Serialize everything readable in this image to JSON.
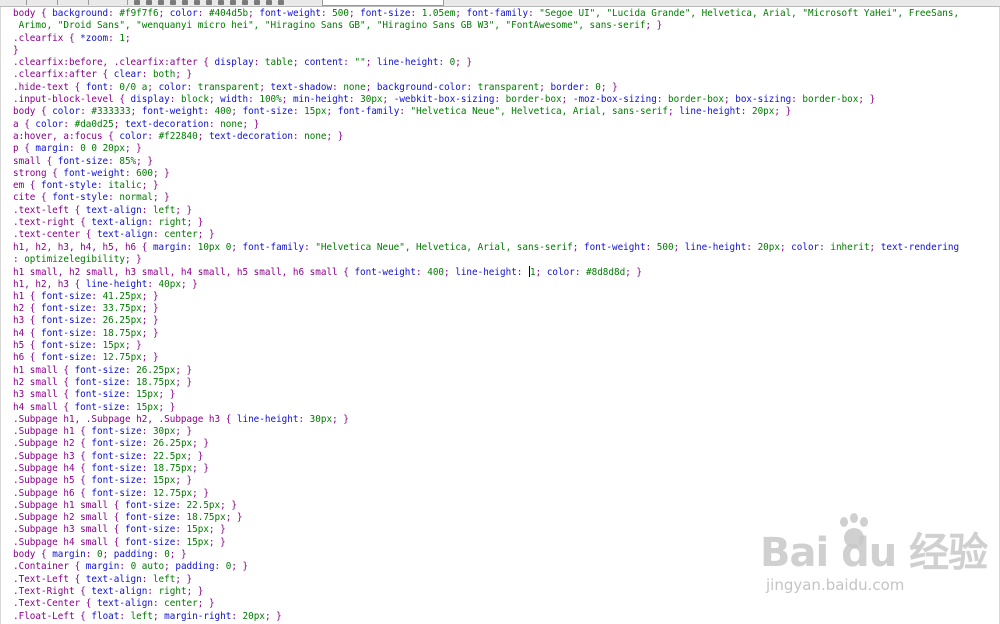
{
  "colors": {
    "selector": "#8a008a",
    "property": "#1010d0",
    "value": "#007a00",
    "background": "#ffffff"
  },
  "icons": [
    "toolbar-icon",
    "paw-icon"
  ],
  "watermark": {
    "logo": "Bai du 经验",
    "url": "jingyan.baidu.com"
  },
  "lines": [
    [
      [
        "s",
        "body { "
      ],
      [
        "p",
        "background"
      ],
      [
        "s",
        ": "
      ],
      [
        "v",
        "#f9f7f6"
      ],
      [
        "s",
        "; "
      ],
      [
        "p",
        "color"
      ],
      [
        "s",
        ": "
      ],
      [
        "v",
        "#404d5b"
      ],
      [
        "s",
        "; "
      ],
      [
        "p",
        "font-weight"
      ],
      [
        "s",
        ": "
      ],
      [
        "v",
        "500"
      ],
      [
        "s",
        "; "
      ],
      [
        "p",
        "font-size"
      ],
      [
        "s",
        ": "
      ],
      [
        "v",
        "1.05em"
      ],
      [
        "s",
        "; "
      ],
      [
        "p",
        "font-family"
      ],
      [
        "s",
        ": "
      ],
      [
        "v",
        "\"Segoe UI\", \"Lucida Grande\", Helvetica, Arial, \"Microsoft YaHei\", FreeSans,"
      ]
    ],
    [
      [
        "v",
        " Arimo, \"Droid Sans\", \"wenquanyi micro hei\", \"Hiragino Sans GB\", \"Hiragino Sans GB W3\", \"FontAwesome\", sans-serif"
      ],
      [
        "s",
        "; }"
      ]
    ],
    [
      [
        "s",
        ".clearfix { "
      ],
      [
        "p",
        "*zoom"
      ],
      [
        "s",
        ": "
      ],
      [
        "v",
        "1"
      ],
      [
        "s",
        ";"
      ]
    ],
    [
      [
        "s",
        "}"
      ]
    ],
    [
      [
        "s",
        ".clearfix:before, .clearfix:after { "
      ],
      [
        "p",
        "display"
      ],
      [
        "s",
        ": "
      ],
      [
        "v",
        "table"
      ],
      [
        "s",
        "; "
      ],
      [
        "p",
        "content"
      ],
      [
        "s",
        ": "
      ],
      [
        "v",
        "\"\""
      ],
      [
        "s",
        "; "
      ],
      [
        "p",
        "line-height"
      ],
      [
        "s",
        ": "
      ],
      [
        "v",
        "0"
      ],
      [
        "s",
        "; }"
      ]
    ],
    [
      [
        "s",
        ".clearfix:after { "
      ],
      [
        "p",
        "clear"
      ],
      [
        "s",
        ": "
      ],
      [
        "v",
        "both"
      ],
      [
        "s",
        "; }"
      ]
    ],
    [
      [
        "s",
        ".hide-text { "
      ],
      [
        "p",
        "font"
      ],
      [
        "s",
        ": "
      ],
      [
        "v",
        "0/0 a"
      ],
      [
        "s",
        "; "
      ],
      [
        "p",
        "color"
      ],
      [
        "s",
        ": "
      ],
      [
        "v",
        "transparent"
      ],
      [
        "s",
        "; "
      ],
      [
        "p",
        "text-shadow"
      ],
      [
        "s",
        ": "
      ],
      [
        "v",
        "none"
      ],
      [
        "s",
        "; "
      ],
      [
        "p",
        "background-color"
      ],
      [
        "s",
        ": "
      ],
      [
        "v",
        "transparent"
      ],
      [
        "s",
        "; "
      ],
      [
        "p",
        "border"
      ],
      [
        "s",
        ": "
      ],
      [
        "v",
        "0"
      ],
      [
        "s",
        "; }"
      ]
    ],
    [
      [
        "s",
        ".input-block-level { "
      ],
      [
        "p",
        "display"
      ],
      [
        "s",
        ": "
      ],
      [
        "v",
        "block"
      ],
      [
        "s",
        "; "
      ],
      [
        "p",
        "width"
      ],
      [
        "s",
        ": "
      ],
      [
        "v",
        "100%"
      ],
      [
        "s",
        "; "
      ],
      [
        "p",
        "min-height"
      ],
      [
        "s",
        ": "
      ],
      [
        "v",
        "30px"
      ],
      [
        "s",
        "; "
      ],
      [
        "p",
        "-webkit-box-sizing"
      ],
      [
        "s",
        ": "
      ],
      [
        "v",
        "border-box"
      ],
      [
        "s",
        "; "
      ],
      [
        "p",
        "-moz-box-sizing"
      ],
      [
        "s",
        ": "
      ],
      [
        "v",
        "border-box"
      ],
      [
        "s",
        "; "
      ],
      [
        "p",
        "box-sizing"
      ],
      [
        "s",
        ": "
      ],
      [
        "v",
        "border-box"
      ],
      [
        "s",
        "; }"
      ]
    ],
    [
      [
        "s",
        "body { "
      ],
      [
        "p",
        "color"
      ],
      [
        "s",
        ": "
      ],
      [
        "v",
        "#333333"
      ],
      [
        "s",
        "; "
      ],
      [
        "p",
        "font-weight"
      ],
      [
        "s",
        ": "
      ],
      [
        "v",
        "400"
      ],
      [
        "s",
        "; "
      ],
      [
        "p",
        "font-size"
      ],
      [
        "s",
        ": "
      ],
      [
        "v",
        "15px"
      ],
      [
        "s",
        "; "
      ],
      [
        "p",
        "font-family"
      ],
      [
        "s",
        ": "
      ],
      [
        "v",
        "\"Helvetica Neue\", Helvetica, Arial, sans-serif"
      ],
      [
        "s",
        "; "
      ],
      [
        "p",
        "line-height"
      ],
      [
        "s",
        ": "
      ],
      [
        "v",
        "20px"
      ],
      [
        "s",
        "; }"
      ]
    ],
    [
      [
        "s",
        "a { "
      ],
      [
        "p",
        "color"
      ],
      [
        "s",
        ": "
      ],
      [
        "v",
        "#da0d25"
      ],
      [
        "s",
        "; "
      ],
      [
        "p",
        "text-decoration"
      ],
      [
        "s",
        ": "
      ],
      [
        "v",
        "none"
      ],
      [
        "s",
        "; }"
      ]
    ],
    [
      [
        "s",
        "a:hover, a:focus { "
      ],
      [
        "p",
        "color"
      ],
      [
        "s",
        ": "
      ],
      [
        "v",
        "#f22840"
      ],
      [
        "s",
        "; "
      ],
      [
        "p",
        "text-decoration"
      ],
      [
        "s",
        ": "
      ],
      [
        "v",
        "none"
      ],
      [
        "s",
        "; }"
      ]
    ],
    [
      [
        "s",
        "p { "
      ],
      [
        "p",
        "margin"
      ],
      [
        "s",
        ": "
      ],
      [
        "v",
        "0 0 20px"
      ],
      [
        "s",
        "; }"
      ]
    ],
    [
      [
        "s",
        "small { "
      ],
      [
        "p",
        "font-size"
      ],
      [
        "s",
        ": "
      ],
      [
        "v",
        "85%"
      ],
      [
        "s",
        "; }"
      ]
    ],
    [
      [
        "s",
        "strong { "
      ],
      [
        "p",
        "font-weight"
      ],
      [
        "s",
        ": "
      ],
      [
        "v",
        "600"
      ],
      [
        "s",
        "; }"
      ]
    ],
    [
      [
        "s",
        "em { "
      ],
      [
        "p",
        "font-style"
      ],
      [
        "s",
        ": "
      ],
      [
        "v",
        "italic"
      ],
      [
        "s",
        "; }"
      ]
    ],
    [
      [
        "s",
        "cite { "
      ],
      [
        "p",
        "font-style"
      ],
      [
        "s",
        ": "
      ],
      [
        "v",
        "normal"
      ],
      [
        "s",
        "; }"
      ]
    ],
    [
      [
        "s",
        ".text-left { "
      ],
      [
        "p",
        "text-align"
      ],
      [
        "s",
        ": "
      ],
      [
        "v",
        "left"
      ],
      [
        "s",
        "; }"
      ]
    ],
    [
      [
        "s",
        ".text-right { "
      ],
      [
        "p",
        "text-align"
      ],
      [
        "s",
        ": "
      ],
      [
        "v",
        "right"
      ],
      [
        "s",
        "; }"
      ]
    ],
    [
      [
        "s",
        ".text-center { "
      ],
      [
        "p",
        "text-align"
      ],
      [
        "s",
        ": "
      ],
      [
        "v",
        "center"
      ],
      [
        "s",
        "; }"
      ]
    ],
    [
      [
        "s",
        "h1, h2, h3, h4, h5, h6 { "
      ],
      [
        "p",
        "margin"
      ],
      [
        "s",
        ": "
      ],
      [
        "v",
        "10px 0"
      ],
      [
        "s",
        "; "
      ],
      [
        "p",
        "font-family"
      ],
      [
        "s",
        ": "
      ],
      [
        "v",
        "\"Helvetica Neue\", Helvetica, Arial, sans-serif"
      ],
      [
        "s",
        "; "
      ],
      [
        "p",
        "font-weight"
      ],
      [
        "s",
        ": "
      ],
      [
        "v",
        "500"
      ],
      [
        "s",
        "; "
      ],
      [
        "p",
        "line-height"
      ],
      [
        "s",
        ": "
      ],
      [
        "v",
        "20px"
      ],
      [
        "s",
        "; "
      ],
      [
        "p",
        "color"
      ],
      [
        "s",
        ": "
      ],
      [
        "v",
        "inherit"
      ],
      [
        "s",
        "; "
      ],
      [
        "p",
        "text-rendering"
      ]
    ],
    [
      [
        "s",
        ": "
      ],
      [
        "v",
        "optimizelegibility"
      ],
      [
        "s",
        "; }"
      ]
    ],
    [
      [
        "s",
        "h1 small, h2 small, h3 small, h4 small, h5 small, h6 small { "
      ],
      [
        "p",
        "font-weight"
      ],
      [
        "s",
        ": "
      ],
      [
        "v",
        "400"
      ],
      [
        "s",
        "; "
      ],
      [
        "p",
        "line-height"
      ],
      [
        "s",
        ": "
      ],
      [
        "c",
        ""
      ],
      [
        "v",
        "1"
      ],
      [
        "s",
        "; "
      ],
      [
        "p",
        "color"
      ],
      [
        "s",
        ": "
      ],
      [
        "v",
        "#8d8d8d"
      ],
      [
        "s",
        "; }"
      ]
    ],
    [
      [
        "s",
        "h1, h2, h3 { "
      ],
      [
        "p",
        "line-height"
      ],
      [
        "s",
        ": "
      ],
      [
        "v",
        "40px"
      ],
      [
        "s",
        "; }"
      ]
    ],
    [
      [
        "s",
        "h1 { "
      ],
      [
        "p",
        "font-size"
      ],
      [
        "s",
        ": "
      ],
      [
        "v",
        "41.25px"
      ],
      [
        "s",
        "; }"
      ]
    ],
    [
      [
        "s",
        "h2 { "
      ],
      [
        "p",
        "font-size"
      ],
      [
        "s",
        ": "
      ],
      [
        "v",
        "33.75px"
      ],
      [
        "s",
        "; }"
      ]
    ],
    [
      [
        "s",
        "h3 { "
      ],
      [
        "p",
        "font-size"
      ],
      [
        "s",
        ": "
      ],
      [
        "v",
        "26.25px"
      ],
      [
        "s",
        "; }"
      ]
    ],
    [
      [
        "s",
        "h4 { "
      ],
      [
        "p",
        "font-size"
      ],
      [
        "s",
        ": "
      ],
      [
        "v",
        "18.75px"
      ],
      [
        "s",
        "; }"
      ]
    ],
    [
      [
        "s",
        "h5 { "
      ],
      [
        "p",
        "font-size"
      ],
      [
        "s",
        ": "
      ],
      [
        "v",
        "15px"
      ],
      [
        "s",
        "; }"
      ]
    ],
    [
      [
        "s",
        "h6 { "
      ],
      [
        "p",
        "font-size"
      ],
      [
        "s",
        ": "
      ],
      [
        "v",
        "12.75px"
      ],
      [
        "s",
        "; }"
      ]
    ],
    [
      [
        "s",
        "h1 small { "
      ],
      [
        "p",
        "font-size"
      ],
      [
        "s",
        ": "
      ],
      [
        "v",
        "26.25px"
      ],
      [
        "s",
        "; }"
      ]
    ],
    [
      [
        "s",
        "h2 small { "
      ],
      [
        "p",
        "font-size"
      ],
      [
        "s",
        ": "
      ],
      [
        "v",
        "18.75px"
      ],
      [
        "s",
        "; }"
      ]
    ],
    [
      [
        "s",
        "h3 small { "
      ],
      [
        "p",
        "font-size"
      ],
      [
        "s",
        ": "
      ],
      [
        "v",
        "15px"
      ],
      [
        "s",
        "; }"
      ]
    ],
    [
      [
        "s",
        "h4 small { "
      ],
      [
        "p",
        "font-size"
      ],
      [
        "s",
        ": "
      ],
      [
        "v",
        "15px"
      ],
      [
        "s",
        "; }"
      ]
    ],
    [
      [
        "s",
        ".Subpage h1, .Subpage h2, .Subpage h3 { "
      ],
      [
        "p",
        "line-height"
      ],
      [
        "s",
        ": "
      ],
      [
        "v",
        "30px"
      ],
      [
        "s",
        "; }"
      ]
    ],
    [
      [
        "s",
        ".Subpage h1 { "
      ],
      [
        "p",
        "font-size"
      ],
      [
        "s",
        ": "
      ],
      [
        "v",
        "30px"
      ],
      [
        "s",
        "; }"
      ]
    ],
    [
      [
        "s",
        ".Subpage h2 { "
      ],
      [
        "p",
        "font-size"
      ],
      [
        "s",
        ": "
      ],
      [
        "v",
        "26.25px"
      ],
      [
        "s",
        "; }"
      ]
    ],
    [
      [
        "s",
        ".Subpage h3 { "
      ],
      [
        "p",
        "font-size"
      ],
      [
        "s",
        ": "
      ],
      [
        "v",
        "22.5px"
      ],
      [
        "s",
        "; }"
      ]
    ],
    [
      [
        "s",
        ".Subpage h4 { "
      ],
      [
        "p",
        "font-size"
      ],
      [
        "s",
        ": "
      ],
      [
        "v",
        "18.75px"
      ],
      [
        "s",
        "; }"
      ]
    ],
    [
      [
        "s",
        ".Subpage h5 { "
      ],
      [
        "p",
        "font-size"
      ],
      [
        "s",
        ": "
      ],
      [
        "v",
        "15px"
      ],
      [
        "s",
        "; }"
      ]
    ],
    [
      [
        "s",
        ".Subpage h6 { "
      ],
      [
        "p",
        "font-size"
      ],
      [
        "s",
        ": "
      ],
      [
        "v",
        "12.75px"
      ],
      [
        "s",
        "; }"
      ]
    ],
    [
      [
        "s",
        ".Subpage h1 small { "
      ],
      [
        "p",
        "font-size"
      ],
      [
        "s",
        ": "
      ],
      [
        "v",
        "22.5px"
      ],
      [
        "s",
        "; }"
      ]
    ],
    [
      [
        "s",
        ".Subpage h2 small { "
      ],
      [
        "p",
        "font-size"
      ],
      [
        "s",
        ": "
      ],
      [
        "v",
        "18.75px"
      ],
      [
        "s",
        "; }"
      ]
    ],
    [
      [
        "s",
        ".Subpage h3 small { "
      ],
      [
        "p",
        "font-size"
      ],
      [
        "s",
        ": "
      ],
      [
        "v",
        "15px"
      ],
      [
        "s",
        "; }"
      ]
    ],
    [
      [
        "s",
        ".Subpage h4 small { "
      ],
      [
        "p",
        "font-size"
      ],
      [
        "s",
        ": "
      ],
      [
        "v",
        "15px"
      ],
      [
        "s",
        "; }"
      ]
    ],
    [
      [
        "s",
        "body { "
      ],
      [
        "p",
        "margin"
      ],
      [
        "s",
        ": "
      ],
      [
        "v",
        "0"
      ],
      [
        "s",
        "; "
      ],
      [
        "p",
        "padding"
      ],
      [
        "s",
        ": "
      ],
      [
        "v",
        "0"
      ],
      [
        "s",
        "; }"
      ]
    ],
    [
      [
        "s",
        ".Container { "
      ],
      [
        "p",
        "margin"
      ],
      [
        "s",
        ": "
      ],
      [
        "v",
        "0 auto"
      ],
      [
        "s",
        "; "
      ],
      [
        "p",
        "padding"
      ],
      [
        "s",
        ": "
      ],
      [
        "v",
        "0"
      ],
      [
        "s",
        "; }"
      ]
    ],
    [
      [
        "s",
        ".Text-Left { "
      ],
      [
        "p",
        "text-align"
      ],
      [
        "s",
        ": "
      ],
      [
        "v",
        "left"
      ],
      [
        "s",
        "; }"
      ]
    ],
    [
      [
        "s",
        ".Text-Right { "
      ],
      [
        "p",
        "text-align"
      ],
      [
        "s",
        ": "
      ],
      [
        "v",
        "right"
      ],
      [
        "s",
        "; }"
      ]
    ],
    [
      [
        "s",
        ".Text-Center { "
      ],
      [
        "p",
        "text-align"
      ],
      [
        "s",
        ": "
      ],
      [
        "v",
        "center"
      ],
      [
        "s",
        "; }"
      ]
    ],
    [
      [
        "s",
        ".Float-Left { "
      ],
      [
        "p",
        "float"
      ],
      [
        "s",
        ": "
      ],
      [
        "v",
        "left"
      ],
      [
        "s",
        "; "
      ],
      [
        "p",
        "margin-right"
      ],
      [
        "s",
        ": "
      ],
      [
        "v",
        "20px"
      ],
      [
        "s",
        "; }"
      ]
    ]
  ]
}
